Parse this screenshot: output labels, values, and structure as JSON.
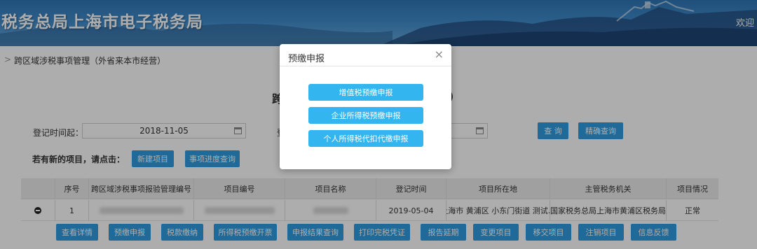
{
  "header": {
    "title": "税务总局上海市电子税务局",
    "welcome": "欢迎"
  },
  "breadcrumb": {
    "separator": ">",
    "current": "跨区域涉税事项管理（外省来本市经营）"
  },
  "page": {
    "title_start": "跨",
    "title_end": ")",
    "start_date_label": "登记时间起：",
    "start_date_value": "2018-11-05",
    "end_date_label": "登",
    "end_date_value": "",
    "query_label": "查 询",
    "precise_query_label": "精确查询",
    "new_project_prompt": "若有新的项目，请点击：",
    "new_project_label": "新建项目",
    "progress_query_label": "事项进度查询"
  },
  "table": {
    "columns": [
      "序号",
      "跨区域涉税事项报验管理编号",
      "项目编号",
      "项目名称",
      "登记时间",
      "项目所在地",
      "主管税务机关",
      "项目情况"
    ],
    "row": {
      "index": "1",
      "date": "2019-05-04",
      "location": "上海市 黄浦区 小东门街道 测试…",
      "tax_office": "国家税务总局上海市黄浦区税务局",
      "status": "正常"
    },
    "actions": [
      "查看详情",
      "预缴申报",
      "税款缴纳",
      "所得税预缴开票",
      "申报结果查询",
      "打印完税凭证",
      "报告延期",
      "变更项目",
      "移交项目",
      "注销项目",
      "信息反馈"
    ]
  },
  "modal": {
    "title": "预缴申报",
    "close": "×",
    "options": [
      "增值税预缴申报",
      "企业所得税预缴申报",
      "个人所得税代扣代缴申报"
    ]
  },
  "colors": {
    "primary_button": "#2f9de0",
    "modal_button": "#33b5f0",
    "header": "#2f76b6"
  }
}
